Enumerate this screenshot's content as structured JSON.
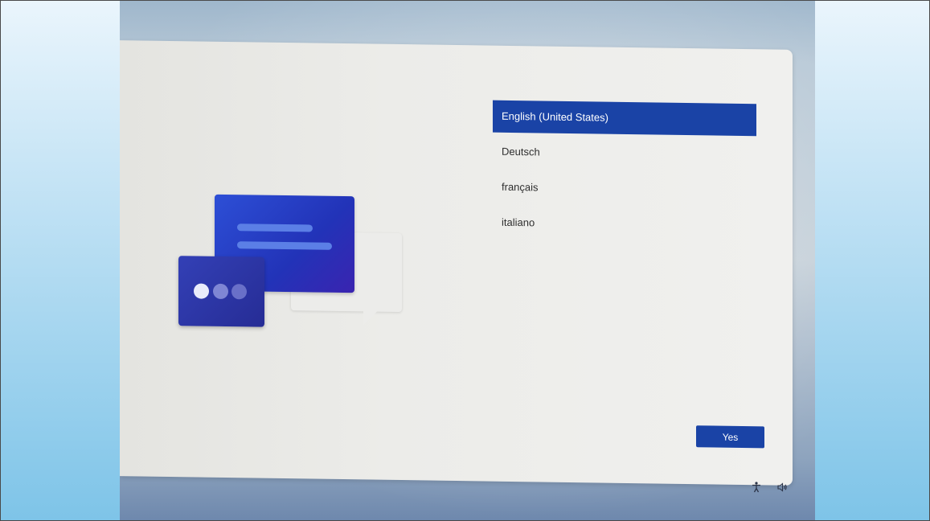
{
  "languages": [
    {
      "label": "English (United States)",
      "selected": true
    },
    {
      "label": "Deutsch",
      "selected": false
    },
    {
      "label": "français",
      "selected": false
    },
    {
      "label": "italiano",
      "selected": false
    }
  ],
  "yes_button_label": "Yes",
  "icons": {
    "accessibility": "accessibility-icon",
    "volume": "volume-icon"
  },
  "colors": {
    "accent": "#1a43a6",
    "outer_background": "#7ec4e8"
  }
}
